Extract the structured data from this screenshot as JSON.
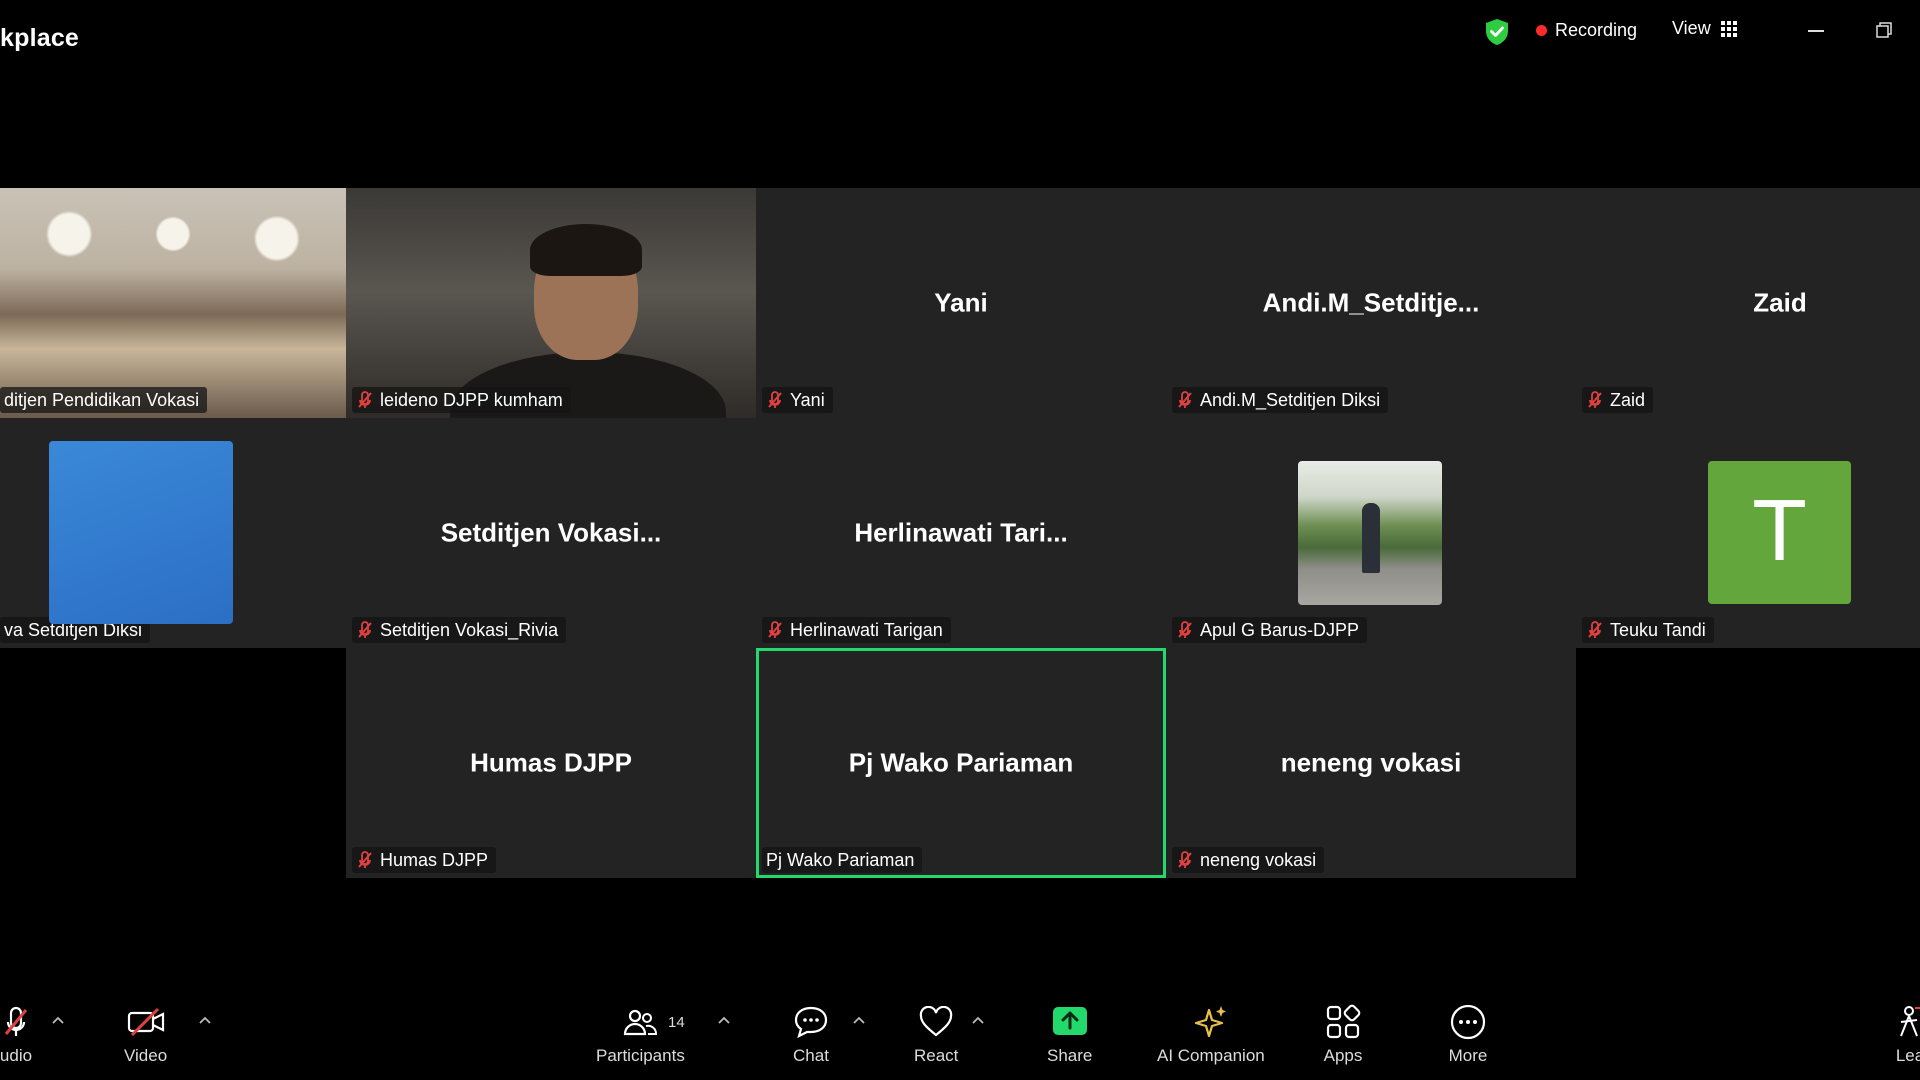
{
  "app": {
    "title_fragment": "kplace"
  },
  "topbar": {
    "recording_label": "Recording",
    "view_label": "View",
    "shield_icon": "shield-check-icon",
    "colors": {
      "recording_dot": "#ff2b2b",
      "shield": "#2ecc40"
    }
  },
  "tiles": [
    {
      "id": "t1",
      "name_tag": "ditjen Pendidikan Vokasi",
      "big_name": "",
      "muted": false
    },
    {
      "id": "t2",
      "name_tag": "leideno DJPP kumham",
      "big_name": "",
      "muted": true
    },
    {
      "id": "t3",
      "name_tag": "Yani",
      "big_name": "Yani",
      "muted": true
    },
    {
      "id": "t4",
      "name_tag": "Andi.M_Setditjen Diksi",
      "big_name": "Andi.M_Setditje...",
      "muted": true
    },
    {
      "id": "t5",
      "name_tag": "Zaid",
      "big_name": "Zaid",
      "muted": true
    },
    {
      "id": "t6",
      "name_tag": "va Setditjen Diksi",
      "big_name": "",
      "muted": false
    },
    {
      "id": "t7",
      "name_tag": "Setditjen Vokasi_Rivia",
      "big_name": "Setditjen  Vokasi...",
      "muted": true
    },
    {
      "id": "t8",
      "name_tag": "Herlinawati Tarigan",
      "big_name": "Herlinawati  Tari...",
      "muted": true
    },
    {
      "id": "t9",
      "name_tag": "Apul G Barus-DJPP",
      "big_name": "",
      "muted": true
    },
    {
      "id": "t10",
      "name_tag": "Teuku Tandi",
      "big_name": "",
      "avatar_letter": "T",
      "muted": true
    },
    {
      "id": "t11",
      "name_tag": "Humas DJPP",
      "big_name": "Humas DJPP",
      "muted": true
    },
    {
      "id": "t12",
      "name_tag": "Pj Wako Pariaman",
      "big_name": "Pj Wako Pariaman",
      "muted": false,
      "active_speaker": true
    },
    {
      "id": "t13",
      "name_tag": "neneng vokasi",
      "big_name": "neneng vokasi",
      "muted": true
    }
  ],
  "toolbar": {
    "audio_label": "udio",
    "video_label": "Video",
    "participants_label": "Participants",
    "participants_count": "14",
    "chat_label": "Chat",
    "react_label": "React",
    "share_label": "Share",
    "ai_label": "AI Companion",
    "apps_label": "Apps",
    "more_label": "More",
    "leave_label": "Lea",
    "colors": {
      "share": "#23d96c",
      "ai": "#e8c04a",
      "muted": "#e04040"
    }
  },
  "colors": {
    "active_speaker_border": "#23d96c",
    "avatar_t": "#63a73c"
  }
}
